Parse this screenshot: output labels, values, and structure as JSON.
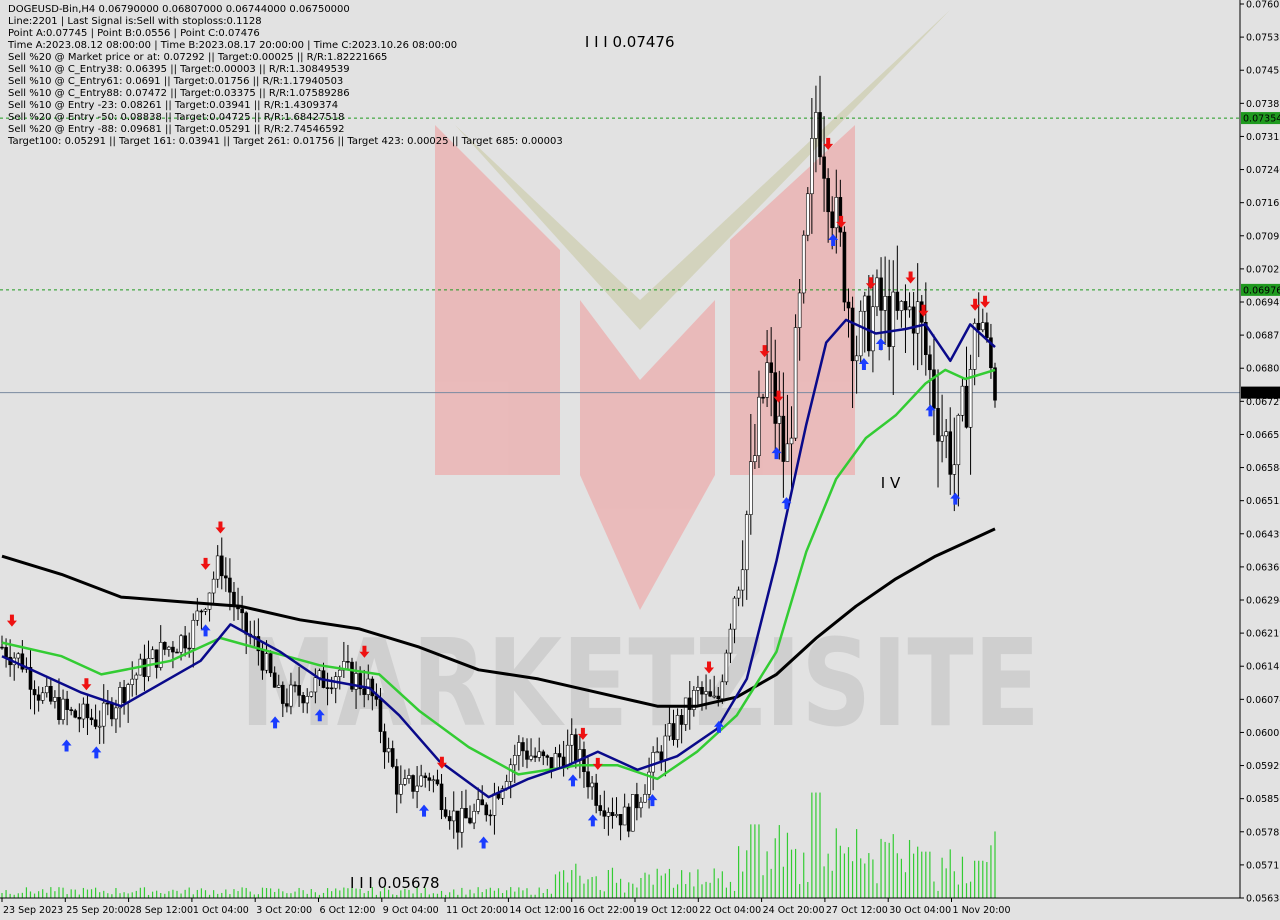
{
  "info_lines": [
    "DOGEUSD-Bin,H4  0.06790000 0.06807000 0.06744000 0.06750000",
    "Line:2201 | Last Signal is:Sell with stoploss:0.1128",
    "Point A:0.07745 | Point B:0.0556 | Point C:0.07476",
    "Time A:2023.08.12 08:00:00 | Time B:2023.08.17 20:00:00 | Time C:2023.10.26 08:00:00",
    "Sell %20 @ Market price or at: 0.07292 || Target:0.00025 || R/R:1.82221665",
    "Sell %10 @ C_Entry38: 0.06395 || Target:0.00003 || R/R:1.30849539",
    "Sell %10 @ C_Entry61: 0.0691 || Target:0.01756 || R/R:1.17940503",
    "Sell %10 @ C_Entry88: 0.07472 || Target:0.03375 || R/R:1.07589286",
    "Sell %10 @ Entry -23: 0.08261 || Target:0.03941 || R/R:1.4309374",
    "Sell %20 @ Entry -50: 0.08838 || Target:0.04725 || R/R:1.68427518",
    "Sell %20 @ Entry -88: 0.09681 || Target:0.05291 || R/R:2.74546592",
    "Target100: 0.05291 || Target 161: 0.03941 || Target 261: 0.01756 || Target 423: 0.00025 || Target 685: 0.00003"
  ],
  "colors": {
    "background": "#e2e2e2",
    "bull_candle": "#000000",
    "bear_candle": "#000000",
    "ma_fast": "#0a0a8a",
    "ma_mid": "#33cc33",
    "ma_slow": "#000000",
    "buy_arrow": "#1a3cff",
    "sell_arrow": "#ee1111",
    "volume": "#33cc33",
    "level_green": "#1f9a1f",
    "current_price_line": "#7a8aa0"
  },
  "watermark_text": "MARKETZISITE",
  "chart_data": {
    "type": "candlestick",
    "symbol": "DOGEUSD-Bin",
    "timeframe": "H4",
    "ylim": [
      0.05638,
      0.07605
    ],
    "y_ticks": [
      "0.07605",
      "0.07532",
      "0.07458",
      "0.07385",
      "0.07312",
      "0.07240",
      "0.07167",
      "0.07095",
      "0.07022",
      "0.06949",
      "0.06875",
      "0.06802",
      "0.06729",
      "0.06657",
      "0.06584",
      "0.06512",
      "0.06439",
      "0.06366",
      "0.06294",
      "0.06219",
      "0.06146",
      "0.06074",
      "0.06001",
      "0.05929",
      "0.05856",
      "0.05783",
      "0.05711",
      "0.05638"
    ],
    "x_ticks": [
      "23 Sep 2023",
      "25 Sep 20:00",
      "28 Sep 12:00",
      "1 Oct 04:00",
      "3 Oct 20:00",
      "6 Oct 12:00",
      "9 Oct 04:00",
      "11 Oct 20:00",
      "14 Oct 12:00",
      "16 Oct 22:00",
      "19 Oct 12:00",
      "22 Oct 04:00",
      "24 Oct 20:00",
      "27 Oct 12:00",
      "30 Oct 04:00",
      "1 Nov 20:00"
    ],
    "current_price": "0.06750",
    "levels": [
      {
        "price": 0.07354,
        "label": "0.07354"
      },
      {
        "price": 0.06976,
        "label": "0.06976"
      }
    ],
    "annotations": [
      {
        "text": "I I I 0.07476",
        "x": 0.587,
        "price": 0.0751
      },
      {
        "text": "I I I 0.05678",
        "x": 0.0,
        "price": 0.0566
      },
      {
        "text": "I V",
        "x": 0.885,
        "price": 0.0654
      }
    ],
    "anchors": [
      {
        "x": 0.0,
        "price": 0.0619
      },
      {
        "x": 0.02,
        "price": 0.0616
      },
      {
        "x": 0.04,
        "price": 0.0608
      },
      {
        "x": 0.07,
        "price": 0.0604
      },
      {
        "x": 0.1,
        "price": 0.0603
      },
      {
        "x": 0.13,
        "price": 0.0612
      },
      {
        "x": 0.16,
        "price": 0.0618
      },
      {
        "x": 0.19,
        "price": 0.0622
      },
      {
        "x": 0.22,
        "price": 0.0638
      },
      {
        "x": 0.24,
        "price": 0.0624
      },
      {
        "x": 0.26,
        "price": 0.0618
      },
      {
        "x": 0.28,
        "price": 0.0607
      },
      {
        "x": 0.31,
        "price": 0.061
      },
      {
        "x": 0.34,
        "price": 0.0614
      },
      {
        "x": 0.37,
        "price": 0.061
      },
      {
        "x": 0.4,
        "price": 0.0587
      },
      {
        "x": 0.43,
        "price": 0.0591
      },
      {
        "x": 0.46,
        "price": 0.058
      },
      {
        "x": 0.49,
        "price": 0.0584
      },
      {
        "x": 0.52,
        "price": 0.0597
      },
      {
        "x": 0.55,
        "price": 0.0593
      },
      {
        "x": 0.575,
        "price": 0.0597
      },
      {
        "x": 0.6,
        "price": 0.0586
      },
      {
        "x": 0.63,
        "price": 0.0581
      },
      {
        "x": 0.66,
        "price": 0.0595
      },
      {
        "x": 0.7,
        "price": 0.0609
      },
      {
        "x": 0.72,
        "price": 0.0606
      },
      {
        "x": 0.75,
        "price": 0.0648
      },
      {
        "x": 0.77,
        "price": 0.068
      },
      {
        "x": 0.79,
        "price": 0.0658
      },
      {
        "x": 0.81,
        "price": 0.071
      },
      {
        "x": 0.82,
        "price": 0.0738
      },
      {
        "x": 0.84,
        "price": 0.0712
      },
      {
        "x": 0.86,
        "price": 0.0685
      },
      {
        "x": 0.88,
        "price": 0.0694
      },
      {
        "x": 0.9,
        "price": 0.069
      },
      {
        "x": 0.92,
        "price": 0.0694
      },
      {
        "x": 0.945,
        "price": 0.0668
      },
      {
        "x": 0.96,
        "price": 0.0659
      },
      {
        "x": 0.985,
        "price": 0.0694
      },
      {
        "x": 1.0,
        "price": 0.0675
      }
    ],
    "ma_fast": [
      [
        0,
        0.0617
      ],
      [
        0.08,
        0.0609
      ],
      [
        0.12,
        0.0606
      ],
      [
        0.2,
        0.0616
      ],
      [
        0.23,
        0.0624
      ],
      [
        0.28,
        0.0618
      ],
      [
        0.32,
        0.0612
      ],
      [
        0.37,
        0.061
      ],
      [
        0.4,
        0.0604
      ],
      [
        0.44,
        0.0594
      ],
      [
        0.49,
        0.0586
      ],
      [
        0.53,
        0.059
      ],
      [
        0.57,
        0.0593
      ],
      [
        0.6,
        0.0596
      ],
      [
        0.64,
        0.0592
      ],
      [
        0.68,
        0.0595
      ],
      [
        0.72,
        0.0601
      ],
      [
        0.75,
        0.0612
      ],
      [
        0.78,
        0.0638
      ],
      [
        0.81,
        0.0668
      ],
      [
        0.83,
        0.0686
      ],
      [
        0.85,
        0.0691
      ],
      [
        0.88,
        0.0688
      ],
      [
        0.91,
        0.0689
      ],
      [
        0.93,
        0.069
      ],
      [
        0.955,
        0.0682
      ],
      [
        0.975,
        0.069
      ],
      [
        1.0,
        0.0685
      ]
    ],
    "ma_mid": [
      [
        0,
        0.062
      ],
      [
        0.06,
        0.0617
      ],
      [
        0.1,
        0.0613
      ],
      [
        0.17,
        0.0616
      ],
      [
        0.22,
        0.0621
      ],
      [
        0.27,
        0.0618
      ],
      [
        0.32,
        0.0615
      ],
      [
        0.38,
        0.0613
      ],
      [
        0.42,
        0.0605
      ],
      [
        0.47,
        0.0597
      ],
      [
        0.52,
        0.0591
      ],
      [
        0.58,
        0.0593
      ],
      [
        0.62,
        0.0593
      ],
      [
        0.66,
        0.059
      ],
      [
        0.7,
        0.0596
      ],
      [
        0.74,
        0.0604
      ],
      [
        0.78,
        0.0618
      ],
      [
        0.81,
        0.064
      ],
      [
        0.84,
        0.0656
      ],
      [
        0.87,
        0.0665
      ],
      [
        0.9,
        0.067
      ],
      [
        0.93,
        0.0677
      ],
      [
        0.95,
        0.068
      ],
      [
        0.97,
        0.0678
      ],
      [
        1.0,
        0.068
      ]
    ],
    "ma_slow": [
      [
        0,
        0.0639
      ],
      [
        0.06,
        0.0635
      ],
      [
        0.12,
        0.063
      ],
      [
        0.18,
        0.0629
      ],
      [
        0.24,
        0.0628
      ],
      [
        0.3,
        0.0625
      ],
      [
        0.36,
        0.0623
      ],
      [
        0.42,
        0.0619
      ],
      [
        0.48,
        0.0614
      ],
      [
        0.54,
        0.0612
      ],
      [
        0.6,
        0.0609
      ],
      [
        0.66,
        0.0606
      ],
      [
        0.7,
        0.0606
      ],
      [
        0.74,
        0.0608
      ],
      [
        0.78,
        0.0613
      ],
      [
        0.82,
        0.0621
      ],
      [
        0.86,
        0.0628
      ],
      [
        0.9,
        0.0634
      ],
      [
        0.94,
        0.0639
      ],
      [
        0.97,
        0.0642
      ],
      [
        1.0,
        0.0645
      ]
    ],
    "buy_arrows": [
      0.065,
      0.095,
      0.205,
      0.275,
      0.32,
      0.425,
      0.485,
      0.575,
      0.595,
      0.655,
      0.722,
      0.78,
      0.79,
      0.837,
      0.868,
      0.885,
      0.935,
      0.96
    ],
    "sell_arrows": [
      0.01,
      0.085,
      0.205,
      0.22,
      0.365,
      0.443,
      0.585,
      0.6,
      0.712,
      0.768,
      0.782,
      0.832,
      0.845,
      0.875,
      0.915,
      0.928,
      0.98,
      0.99
    ],
    "volume_peaks": [
      [
        0.76,
        0.058
      ],
      [
        0.82,
        0.0587
      ],
      [
        0.93,
        0.0574
      ],
      [
        0.985,
        0.0572
      ]
    ]
  }
}
